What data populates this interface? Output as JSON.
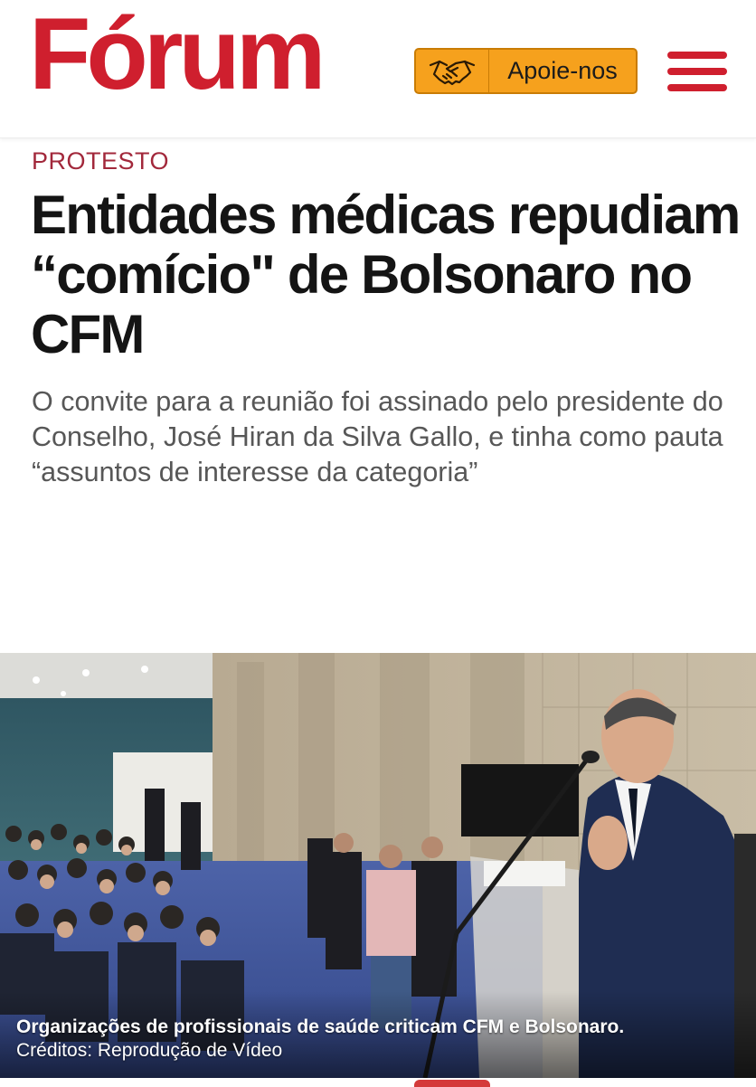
{
  "header": {
    "logo_text": "Fórum",
    "support_label": "Apoie-nos",
    "support_icon": "handshake-icon",
    "menu_icon": "hamburger-menu-icon",
    "brand_color": "#cf1f2e",
    "support_color": "#f6a11d"
  },
  "article": {
    "category": "PROTESTO",
    "title": "Entidades médicas repudiam “comício\" de Bolsonaro no CFM",
    "subtitle": "O convite para a reunião foi assinado pelo presidente do Conselho, José Hiran da Silva Gallo, e tinha como pauta “assuntos de interesse da categoria”"
  },
  "photo": {
    "caption": "Organizações de profissionais de saúde criticam CFM e Bolsonaro.",
    "credits": "Créditos: Reprodução de Vídeo"
  }
}
